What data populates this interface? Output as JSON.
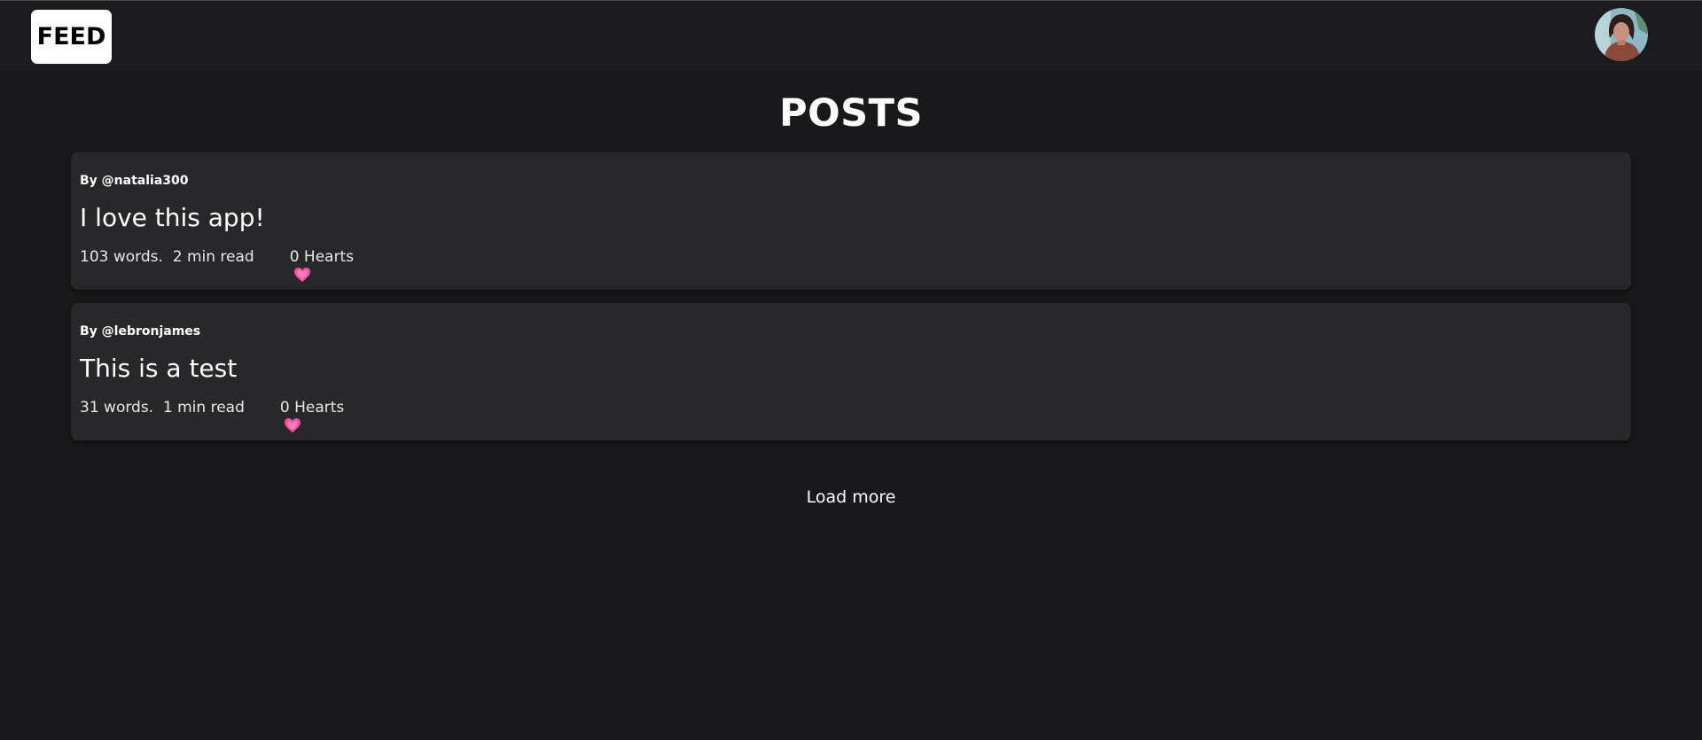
{
  "header": {
    "logo_label": "FEED",
    "avatar_icon": "user-avatar"
  },
  "main": {
    "title": "POSTS",
    "posts": [
      {
        "author": "By @natalia300",
        "title": "I love this app!",
        "words": "103 words.",
        "read_time": "2 min read",
        "hearts": "0 Hearts"
      },
      {
        "author": "By @lebronjames",
        "title": "This is a test",
        "words": "31 words.",
        "read_time": "1 min read",
        "hearts": "0 Hearts"
      }
    ],
    "load_more_label": "Load more"
  },
  "colors": {
    "background": "#19191b",
    "card": "#28282b",
    "heart": "#ff4fa3"
  }
}
